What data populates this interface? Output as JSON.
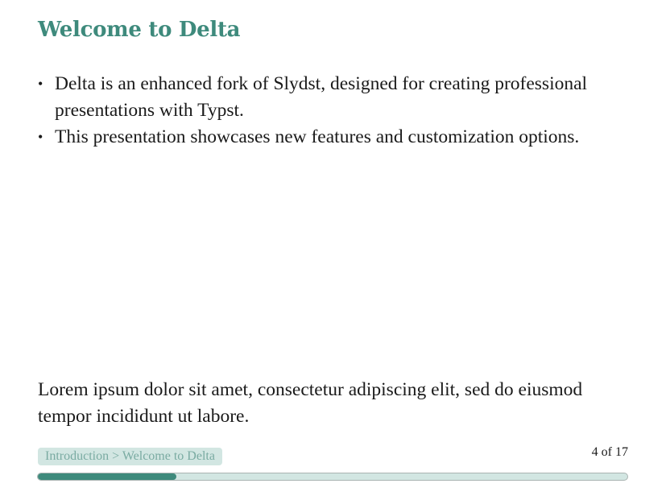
{
  "slide": {
    "title": "Welcome to Delta",
    "bullets": [
      "Delta is an enhanced fork of Slydst, designed for creating professional presentations with Typst.",
      "This presentation showcases new features and customization options."
    ],
    "bullet_marker": "•",
    "body_text": "Lorem ipsum dolor sit amet, consectetur adipiscing elit, sed do eiusmod tempor incididunt ut labore."
  },
  "footer": {
    "breadcrumb": "Introduction > Welcome to Delta",
    "page_counter": "4 of 17",
    "progress_fraction": 0.235
  },
  "colors": {
    "accent": "#3e8a7c",
    "accent_light": "#d2e6e2",
    "breadcrumb_text": "#7aaba2"
  }
}
